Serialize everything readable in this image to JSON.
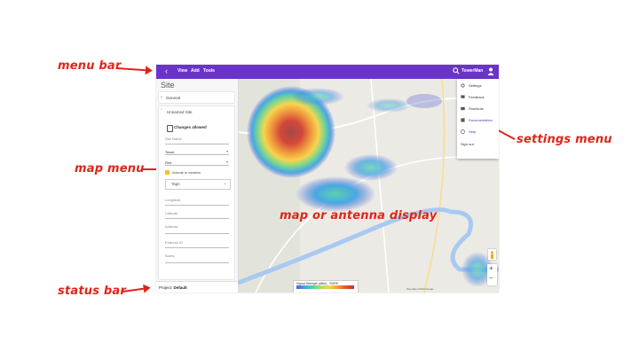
{
  "annotations": {
    "menu_bar": "menu bar",
    "map_menu": "map menu",
    "status_bar": "status bar",
    "settings_menu": "settings menu",
    "map_display": "map or antenna display"
  },
  "topbar": {
    "back_glyph": "‹",
    "menu": [
      "View",
      "Add",
      "Tools"
    ],
    "user_name": "TowerMan"
  },
  "sidebar": {
    "title": "Site",
    "general_label": "General",
    "unnamed_site_label": "Unnamed Site",
    "changes_allowed": "Changes allowed",
    "fields": {
      "site_name": "Site Name",
      "type_value": "Tower",
      "color_value": "Red",
      "include_clusters": "Include in clusters",
      "tags": "Tags",
      "longitude": "Longitude",
      "latitude": "Latitude",
      "address": "Address",
      "external_id": "External ID",
      "notes": "Notes"
    }
  },
  "status_bar": {
    "project_label": "Project:",
    "project_value": "Default"
  },
  "settings_menu": {
    "items": [
      "Settings",
      "Feedback",
      "Shortcuts",
      "Documentation",
      "Help",
      "Sign out"
    ]
  },
  "legend": {
    "title": "Signal Strength (dBm) - RSRP"
  },
  "map": {
    "attribution": "Map data ©2020 Google"
  }
}
